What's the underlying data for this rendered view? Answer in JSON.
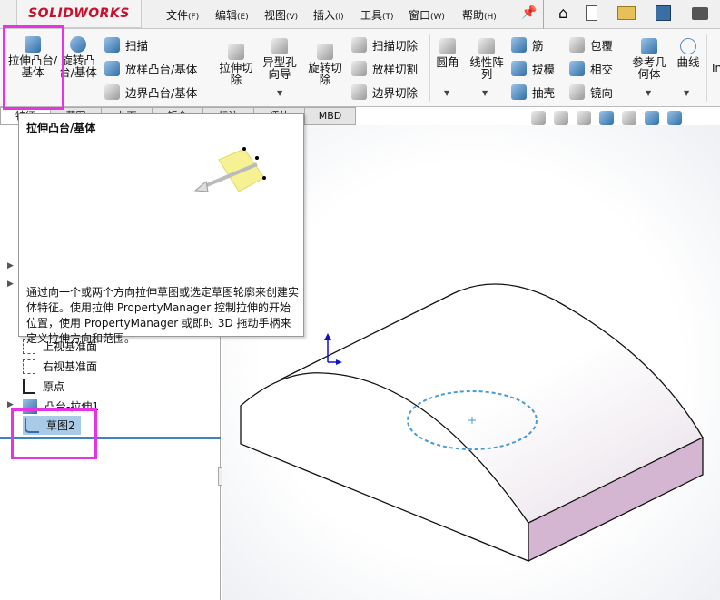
{
  "app": {
    "logo": "SOLIDWORKS"
  },
  "menu": [
    {
      "label": "文件",
      "key": "(F)"
    },
    {
      "label": "编辑",
      "key": "(E)"
    },
    {
      "label": "视图",
      "key": "(V)"
    },
    {
      "label": "插入",
      "key": "(I)"
    },
    {
      "label": "工具",
      "key": "(T)"
    },
    {
      "label": "窗口",
      "key": "(W)"
    },
    {
      "label": "帮助",
      "key": "(H)"
    }
  ],
  "quick_icons": [
    "home-icon",
    "new-document-icon",
    "open-icon",
    "save-icon",
    "print-icon"
  ],
  "ribbon": {
    "extrude_boss": "拉伸凸台/基体",
    "revolve_boss": "旋转凸台/基体",
    "sweep": "扫描",
    "loft": "放样凸台/基体",
    "boundary": "边界凸台/基体",
    "extrude_cut": "拉伸切除",
    "hole_wizard": "异型孔向导",
    "revolve_cut": "旋转切除",
    "sweep_cut": "扫描切除",
    "loft_cut": "放样切割",
    "boundary_cut": "边界切除",
    "fillet": "圆角",
    "linear_pattern": "线性阵列",
    "rib": "筋",
    "draft": "拔模",
    "shell": "抽壳",
    "wrap": "包覆",
    "intersect": "相交",
    "mirror": "镜向",
    "ref_geometry": "参考几何体",
    "curves": "曲线",
    "instant3d": "In"
  },
  "tabs": [
    "特征",
    "草图",
    "曲面",
    "钣金",
    "标注",
    "评估",
    "MBD"
  ],
  "tooltip": {
    "title": "拉伸凸台/基体",
    "body": "通过向一个或两个方向拉伸草图或选定草图轮廓来创建实体特征。使用拉伸 PropertyManager 控制拉伸的开始位置，使用 PropertyManager 或即时 3D 拖动手柄来定义拉伸方向和范围。"
  },
  "tree": {
    "top_plane": "上视基准面",
    "right_plane": "右视基准面",
    "origin": "原点",
    "boss_extrude": "凸台-拉伸1",
    "sketch2": "草图2"
  },
  "colors": {
    "highlight": "#e633e6",
    "sketch": "#4a9ad6",
    "side_face": "#d4b5d2"
  }
}
